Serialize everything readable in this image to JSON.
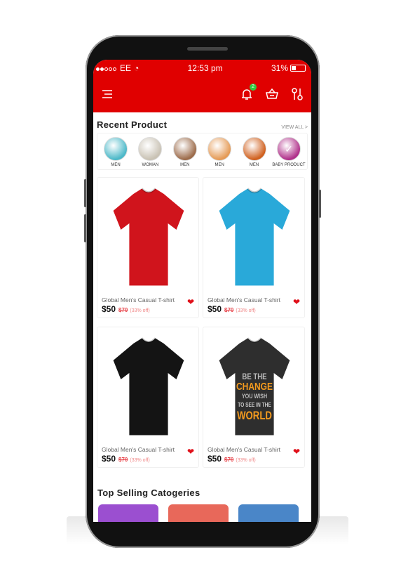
{
  "status": {
    "carrier": "EE",
    "time": "12:53 pm",
    "battery": "31%"
  },
  "header": {
    "notification_count": "2"
  },
  "recent": {
    "title": "Recent Product",
    "view_all": "VIEW ALL >",
    "categories": [
      {
        "label": "MEN",
        "color": "#4bb8c8"
      },
      {
        "label": "WOMAN",
        "color": "#c9c2b4"
      },
      {
        "label": "MEN",
        "color": "#9c6b4a"
      },
      {
        "label": "MEN",
        "color": "#e59a55"
      },
      {
        "label": "MEN",
        "color": "#d0601e"
      },
      {
        "label": "BABY PRODUCT",
        "color": "#b0308a"
      }
    ]
  },
  "products": [
    {
      "name": "Global Men's Casual T-shirt",
      "price": "$50",
      "old_price": "$70",
      "discount": "(33% off)",
      "color": "#d0141c"
    },
    {
      "name": "Global Men's Casual T-shirt",
      "price": "$50",
      "old_price": "$70",
      "discount": "(33% off)",
      "color": "#29a9d9"
    },
    {
      "name": "Global Men's Casual T-shirt",
      "price": "$50",
      "old_price": "$70",
      "discount": "(33% off)",
      "color": "#141414"
    },
    {
      "name": "Global Men's Casual T-shirt",
      "price": "$50",
      "old_price": "$70",
      "discount": "(33% off)",
      "color": "#2e2e2e",
      "print": [
        "BE THE",
        "CHANGE",
        "YOU WISH",
        "TO SEE IN THE",
        "WORLD"
      ]
    }
  ],
  "top_selling": {
    "title": "Top Selling Catogeries",
    "tiles": [
      "#9b4fd0",
      "#e8685a",
      "#4a86c8"
    ]
  }
}
